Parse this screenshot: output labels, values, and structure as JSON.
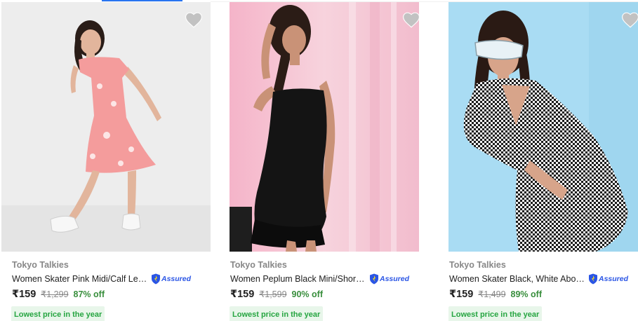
{
  "colors": {
    "accent": "#2874f0",
    "brand_grey": "#878787",
    "offer_green": "#388e3c",
    "badge_bg": "#e8f6ea",
    "badge_text": "#26a541",
    "assured_blue": "#2a55e5",
    "heart_grey": "#c2c2c2"
  },
  "products": [
    {
      "brand": "Tokyo Talkies",
      "title": "Women Skater Pink Midi/Calf Length Dress",
      "assured_label": "Assured",
      "price": "₹159",
      "mrp": "₹1,299",
      "discount": "87% off",
      "badge": "Lowest price in the year",
      "wishlist_icon": "heart-icon",
      "image": "woman in pink floral midi dress"
    },
    {
      "brand": "Tokyo Talkies",
      "title": "Women Peplum Black Mini/Short Dress",
      "assured_label": "Assured",
      "price": "₹159",
      "mrp": "₹1,599",
      "discount": "90% off",
      "badge": "Lowest price in the year",
      "wishlist_icon": "heart-icon",
      "image": "woman in black ruched mini dress"
    },
    {
      "brand": "Tokyo Talkies",
      "title": "Women Skater Black, White Above Knee Dress",
      "assured_label": "Assured",
      "price": "₹159",
      "mrp": "₹1,499",
      "discount": "89% off",
      "badge": "Lowest price in the year",
      "wishlist_icon": "heart-icon",
      "image": "woman in houndstooth wrap dress with sunglasses"
    }
  ]
}
